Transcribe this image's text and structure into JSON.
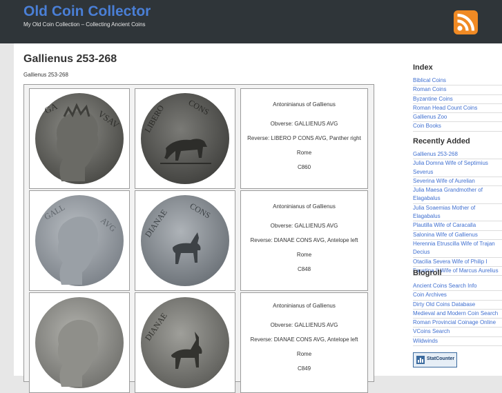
{
  "site": {
    "title": "Old Coin Collector",
    "tagline": "My Old Coin Collection – Collecting Ancient Coins"
  },
  "post": {
    "title": "Gallienus 253-268",
    "subtitle": "Gallienus 253-268",
    "coins": [
      {
        "name": "Antoninianus of Gallienus",
        "obverse": "Obverse: GALLIENUS AVG",
        "reverse": "Reverse: LIBERO P CONS AVG, Panther right",
        "mint": "Rome",
        "ref": "C860"
      },
      {
        "name": "Antoninianus of Gallienus",
        "obverse": "Obverse: GALLIENUS AVG",
        "reverse": "Reverse: DIANAE CONS AVG, Antelope left",
        "mint": "Rome",
        "ref": "C848"
      },
      {
        "name": "Antoninianus of Gallienus",
        "obverse": "Obverse: GALLIENUS AVG",
        "reverse": "Reverse: DIANAE CONS AVG, Antelope left",
        "mint": "Rome",
        "ref": "C849"
      }
    ]
  },
  "sidebar": {
    "index": {
      "heading": "Index",
      "items": [
        "Biblical Coins",
        "Roman Coins",
        "Byzantine Coins",
        "Roman Head Count Coins",
        "Gallienus Zoo",
        "Coin Books"
      ]
    },
    "recent": {
      "heading": "Recently Added",
      "items": [
        "Gallienus 253-268",
        "Julia Domna Wife of Septimius Severus",
        "Severina Wife of Aurelian",
        "Julia Maesa Grandmother of Elagabalus",
        "Julia Soaemias Mother of Elagabalus",
        "Plautilla Wife of Caracalla",
        "Salonina Wife of Gallienus",
        "Herennia Etruscilla Wife of Trajan Decius",
        "Otacilia Severa Wife of Philip I",
        "Faustina II Wife of Marcus Aurelius"
      ]
    },
    "blogroll": {
      "heading": "Blogroll",
      "items": [
        "Ancient Coins Search Info",
        "Coin Archives",
        "Dirty Old Coins Database",
        "Medieval and Modern Coin Search",
        "Roman Provincial Coinage Online",
        "VCoins Search",
        "Wildwinds"
      ]
    },
    "statcounter": "StatCounter"
  },
  "colors": {
    "header_bg": "#2f3539",
    "title_blue": "#4a7fd6",
    "link_blue": "#3f6fd0",
    "rss_orange": "#f08a24"
  }
}
